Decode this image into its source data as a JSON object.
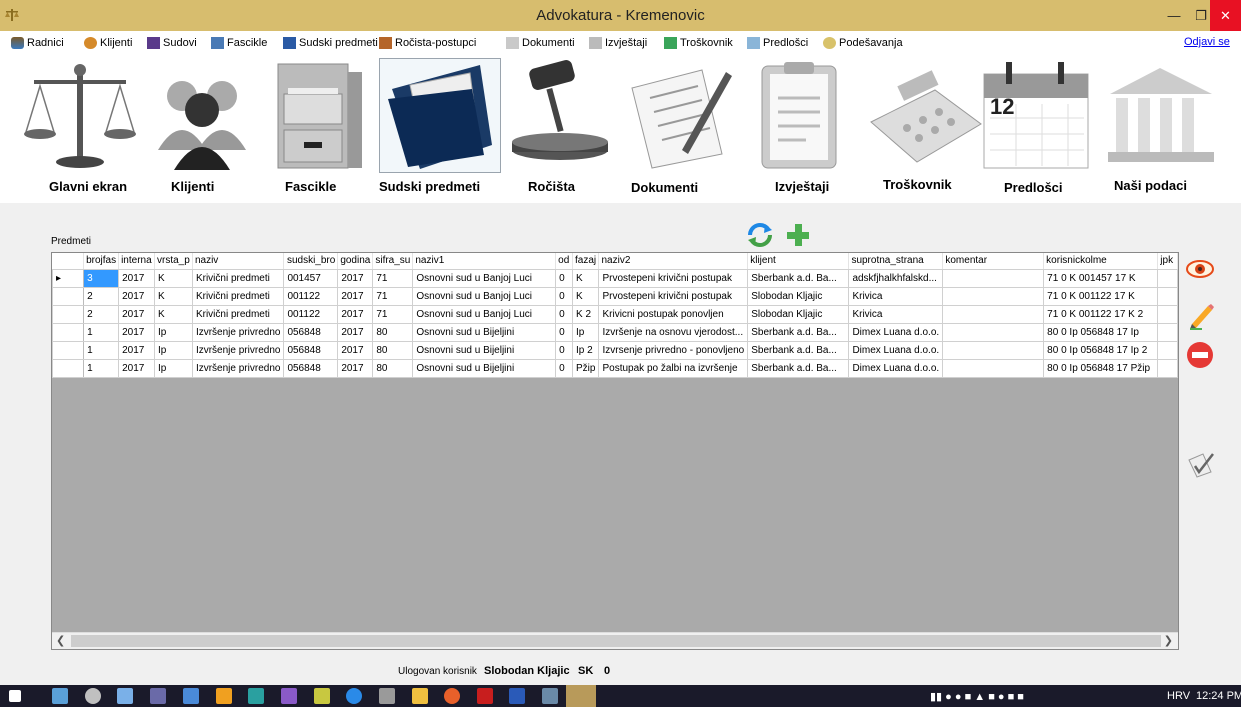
{
  "window": {
    "title": "Advokatura - Kremenovic"
  },
  "menu": {
    "items": [
      "Radnici",
      "Klijenti",
      "Sudovi",
      "Fascikle",
      "Sudski predmeti",
      "Ročista-postupci",
      "Dokumenti",
      "Izvještaji",
      "Troškovnik",
      "Predlošci",
      "Podešavanja"
    ],
    "logout": "Odjavi se"
  },
  "nav": [
    "Glavni ekran",
    "Klijenti",
    "Fascikle",
    "Sudski predmeti",
    "Ročišta",
    "Dokumenti",
    "Izvještaji",
    "Troškovnik",
    "Predlošci",
    "Naši podaci"
  ],
  "calendar_day": "12",
  "grid": {
    "caption": "Predmeti",
    "columns": [
      "brojfas",
      "interna",
      "vrsta_p",
      "naziv",
      "sudski_bro",
      "godina",
      "sifra_su",
      "naziv1",
      "od",
      "fazaj",
      "naziv2",
      "klijent",
      "suprotna_strana",
      "komentar",
      "korisnickolme",
      "jpk"
    ],
    "rows": [
      [
        "3",
        "2017",
        "K",
        "Krivični predmeti",
        "001457",
        "2017",
        "71",
        "Osnovni sud u Banjoj Luci",
        "0",
        "K",
        "Prvostepeni krivični postupak",
        "Sberbank a.d. Ba...",
        "adskfjhalkhfalskd...",
        "",
        "71 0 K 001457 17 K",
        ""
      ],
      [
        "2",
        "2017",
        "K",
        "Krivični predmeti",
        "001122",
        "2017",
        "71",
        "Osnovni sud u Banjoj Luci",
        "0",
        "K",
        "Prvostepeni krivični postupak",
        "Slobodan Kljajic",
        "Krivica",
        "",
        "71 0 K 001122 17 K",
        ""
      ],
      [
        "2",
        "2017",
        "K",
        "Krivični predmeti",
        "001122",
        "2017",
        "71",
        "Osnovni sud u Banjoj Luci",
        "0",
        "K 2",
        "Krivicni postupak ponovljen",
        "Slobodan Kljajic",
        "Krivica",
        "",
        "71 0 K 001122 17 K 2",
        ""
      ],
      [
        "1",
        "2017",
        "Ip",
        "Izvršenje privredno",
        "056848",
        "2017",
        "80",
        "Osnovni sud u Bijeljini",
        "0",
        "Ip",
        "Izvršenje na osnovu vjerodost...",
        "Sberbank a.d. Ba...",
        "Dimex Luana d.o.o.",
        "",
        "80 0 Ip 056848 17 Ip",
        ""
      ],
      [
        "1",
        "2017",
        "Ip",
        "Izvršenje privredno",
        "056848",
        "2017",
        "80",
        "Osnovni sud u Bijeljini",
        "0",
        "Ip 2",
        "Izvrsenje privredno - ponovljeno",
        "Sberbank a.d. Ba...",
        "Dimex Luana d.o.o.",
        "",
        "80 0 Ip 056848 17 Ip 2",
        ""
      ],
      [
        "1",
        "2017",
        "Ip",
        "Izvršenje privredno",
        "056848",
        "2017",
        "80",
        "Osnovni sud u Bijeljini",
        "0",
        "Pžip",
        "Postupak po žalbi na izvršenje",
        "Sberbank a.d. Ba...",
        "Dimex Luana d.o.o.",
        "",
        "80 0 Ip 056848 17 Pžip",
        ""
      ]
    ]
  },
  "status": {
    "label": "Ulogovan korisnik",
    "user": "Slobodan Kljajic",
    "code": "SK",
    "count": "0"
  },
  "taskbar": {
    "lang": "HRV",
    "time": "12:24 PM"
  }
}
